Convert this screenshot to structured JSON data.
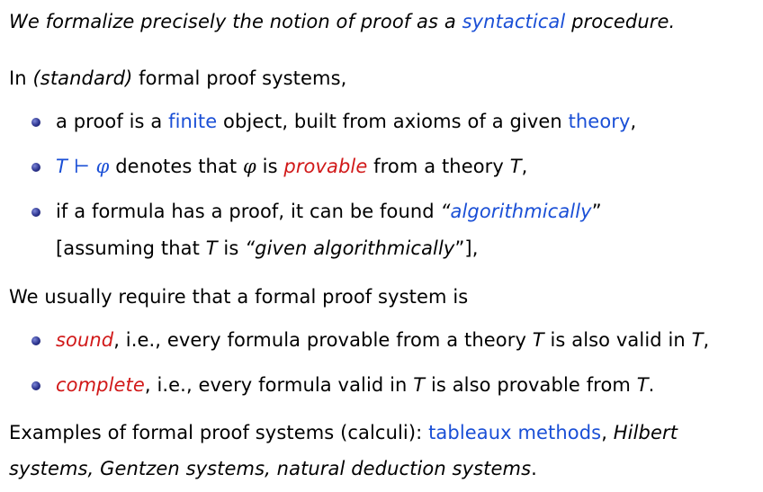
{
  "intro": {
    "p1": "We formalize precisely the notion of proof as a ",
    "p1_link": "syntactical",
    "p1_end": " procedure."
  },
  "standard": {
    "lead_a": "In ",
    "lead_b": "(standard)",
    "lead_c": " formal proof systems,",
    "b1_a": "a proof is a ",
    "b1_finite": "finite",
    "b1_b": " object, built from axioms of a given ",
    "b1_theory": "theory",
    "b1_c": ",",
    "b2_T": "T",
    "b2_turnstile": " ⊢ ",
    "b2_phi": "φ",
    "b2_a": " denotes that ",
    "b2_phi2": "φ",
    "b2_b": " is ",
    "b2_provable": "provable",
    "b2_c": " from a theory ",
    "b2_T2": "T",
    "b2_d": ",",
    "b3_a": "if a formula has a proof, it can be found ",
    "b3_q1": "“",
    "b3_alg": "algorithmically",
    "b3_q2": "”",
    "b3_line2_a": "[assuming that ",
    "b3_line2_T": "T",
    "b3_line2_b": " is ",
    "b3_line2_given": "“given algorithmically",
    "b3_line2_c": "”],"
  },
  "require": {
    "lead": "We usually require that a formal proof system is",
    "b1_sound": "sound",
    "b1_a": ", i.e., every formula provable from a theory ",
    "b1_T": "T",
    "b1_b": " is also valid in ",
    "b1_T2": "T",
    "b1_c": ",",
    "b2_complete": "complete",
    "b2_a": ", i.e., every formula valid in ",
    "b2_T": "T",
    "b2_b": " is also provable from ",
    "b2_T2": "T",
    "b2_c": "."
  },
  "examples": {
    "a": "Examples of formal proof systems (calculi): ",
    "tableaux": "tableaux methods",
    "b": ", ",
    "hilbert": "Hilbert",
    "line2": "systems, Gentzen systems, natural deduction systems",
    "line2_end": "."
  }
}
